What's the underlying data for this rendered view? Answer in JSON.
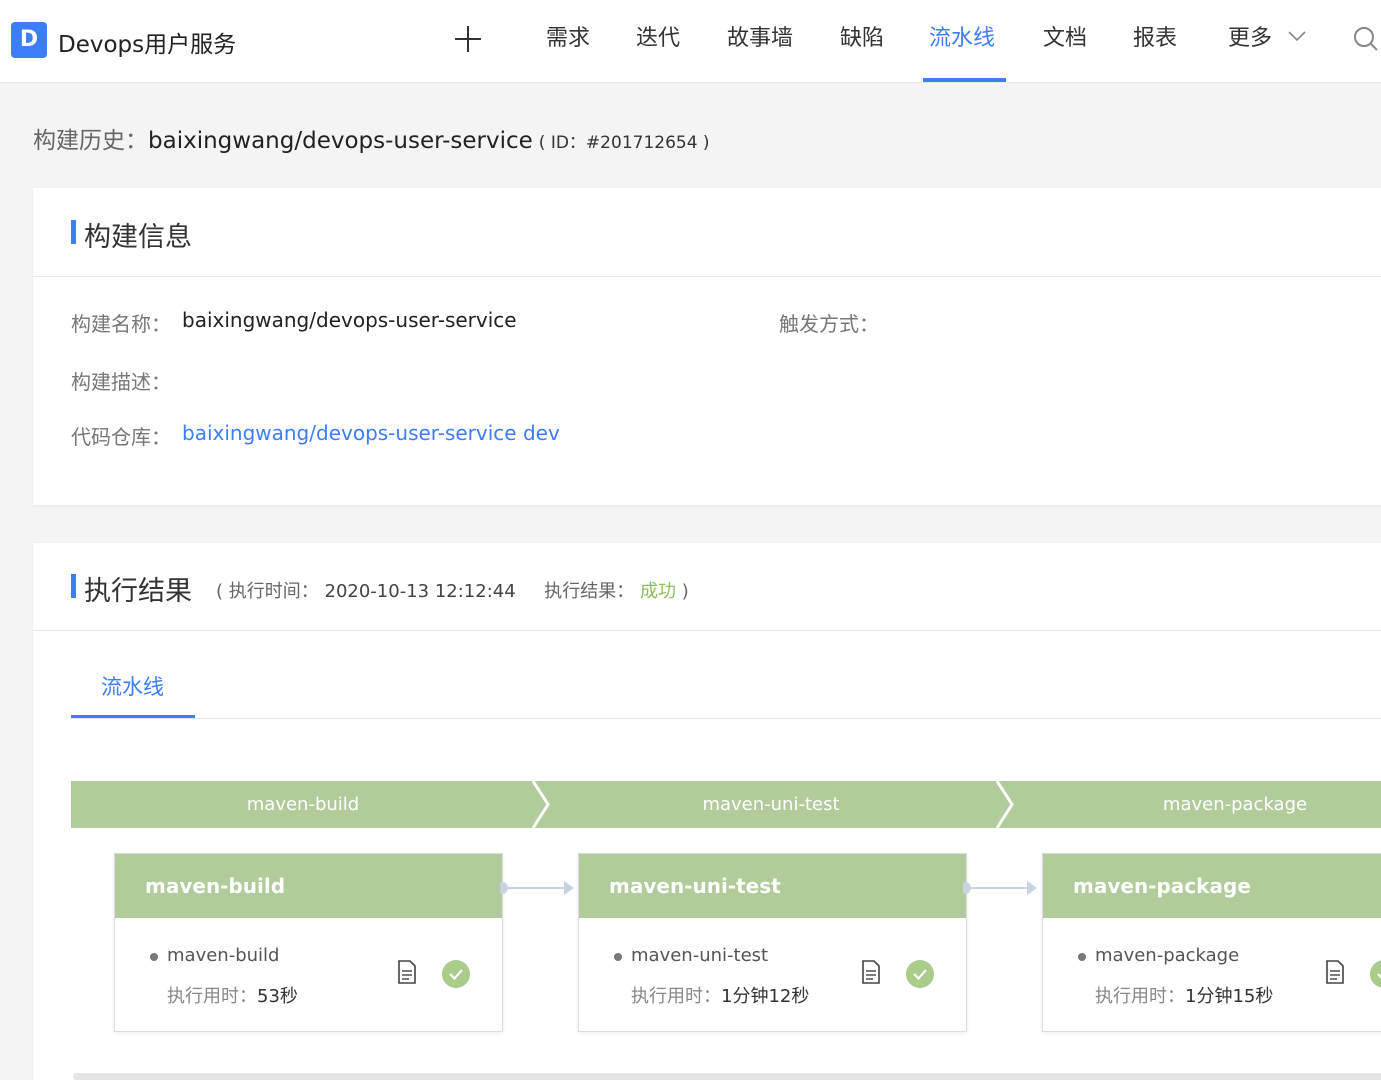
{
  "app": {
    "logo_letter": "D",
    "name": "Devops用户服务"
  },
  "nav": {
    "items": [
      "需求",
      "迭代",
      "故事墙",
      "缺陷",
      "流水线",
      "文档",
      "报表",
      "更多"
    ],
    "active": "流水线"
  },
  "heading": {
    "label": "构建历史：",
    "name": "baixingwang/devops-user-service",
    "id_text": "( ID：#201712654 )"
  },
  "build_info": {
    "title": "构建信息",
    "name_label": "构建名称：",
    "name_value": "baixingwang/devops-user-service",
    "trigger_label": "触发方式：",
    "desc_label": "构建描述：",
    "repo_label": "代码仓库：",
    "repo_value": "baixingwang/devops-user-service dev"
  },
  "exec_result": {
    "title": "执行结果",
    "open": "(",
    "time_label": "执行时间：",
    "time_value": "2020-10-13 12:12:44",
    "result_label": "执行结果：",
    "result_value": "成功",
    "close": ")",
    "tab": "流水线"
  },
  "stages": [
    "maven-build",
    "maven-uni-test",
    "maven-package"
  ],
  "jobs": [
    {
      "title": "maven-build",
      "step": "maven-build",
      "time_label": "执行用时：",
      "time": "53秒"
    },
    {
      "title": "maven-uni-test",
      "step": "maven-uni-test",
      "time_label": "执行用时：",
      "time": "1分钟12秒"
    },
    {
      "title": "maven-package",
      "step": "maven-package",
      "time_label": "执行用时：",
      "time": "1分钟15秒"
    }
  ],
  "colors": {
    "accent": "#3d7ef7",
    "stage_green": "#b2cb9a",
    "success": "#8bbf5e"
  },
  "icons": [
    "plus-icon",
    "chevron-down-icon",
    "search-icon",
    "log-file-icon",
    "success-check-icon"
  ]
}
